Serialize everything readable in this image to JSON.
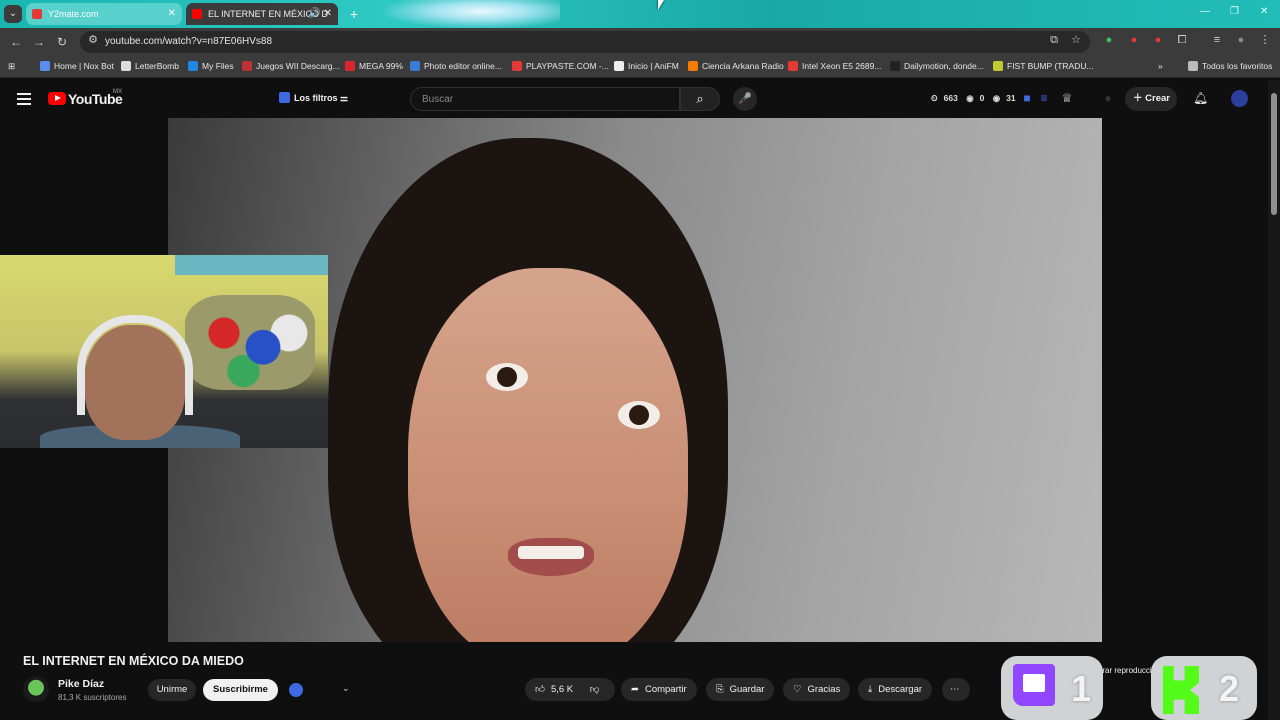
{
  "browser": {
    "tabs": [
      {
        "label": "Y2mate.com",
        "favicon_color": "#e53935"
      },
      {
        "label": "EL INTERNET EN MÉXICO D",
        "favicon_color": "#ff0000"
      }
    ],
    "url": "youtube.com/watch?v=n87E06HVs88",
    "bookmarks": [
      {
        "label": "Home | Nox Bot",
        "color": "#5b8def"
      },
      {
        "label": "LetterBomb",
        "color": "#dddddd"
      },
      {
        "label": "My Files",
        "color": "#1e88e5"
      },
      {
        "label": "Juegos WII Descarg...",
        "color": "#b33"
      },
      {
        "label": "MEGA 99%",
        "color": "#d9272e"
      },
      {
        "label": "Photo editor online...",
        "color": "#3a7bd5"
      },
      {
        "label": "PLAYPASTE.COM -...",
        "color": "#e53935"
      },
      {
        "label": "Inicio | AniFM",
        "color": "#eeeeee"
      },
      {
        "label": "Ciencia Arkana Radio",
        "color": "#f57c00"
      },
      {
        "label": "Intel Xeon E5 2689...",
        "color": "#e53935"
      },
      {
        "label": "Dailymotion, donde...",
        "color": "#222222"
      },
      {
        "label": "FIST BUMP (TRADU...",
        "color": "#c0ca33"
      }
    ],
    "all_bookmarks": "Todos los favoritos"
  },
  "youtube": {
    "logo": "YouTube",
    "country": "MX",
    "filters": "Los filtros",
    "search_placeholder": "Buscar",
    "stats": [
      "663",
      "0",
      "31"
    ],
    "create": "Crear"
  },
  "video": {
    "title": "EL INTERNET EN MÉXICO DA MIEDO",
    "channel": "Pike Díaz",
    "subscribers": "81,3 K suscriptores",
    "join": "Unirme",
    "subscribe": "Suscribirme",
    "likes": "5,6 K",
    "share": "Compartir",
    "save": "Guardar",
    "thanks": "Gracias",
    "download": "Descargar"
  },
  "overlay": {
    "twitch_count": "1",
    "kick_count": "2",
    "repro_text": "Mostrar reproducción del c"
  }
}
